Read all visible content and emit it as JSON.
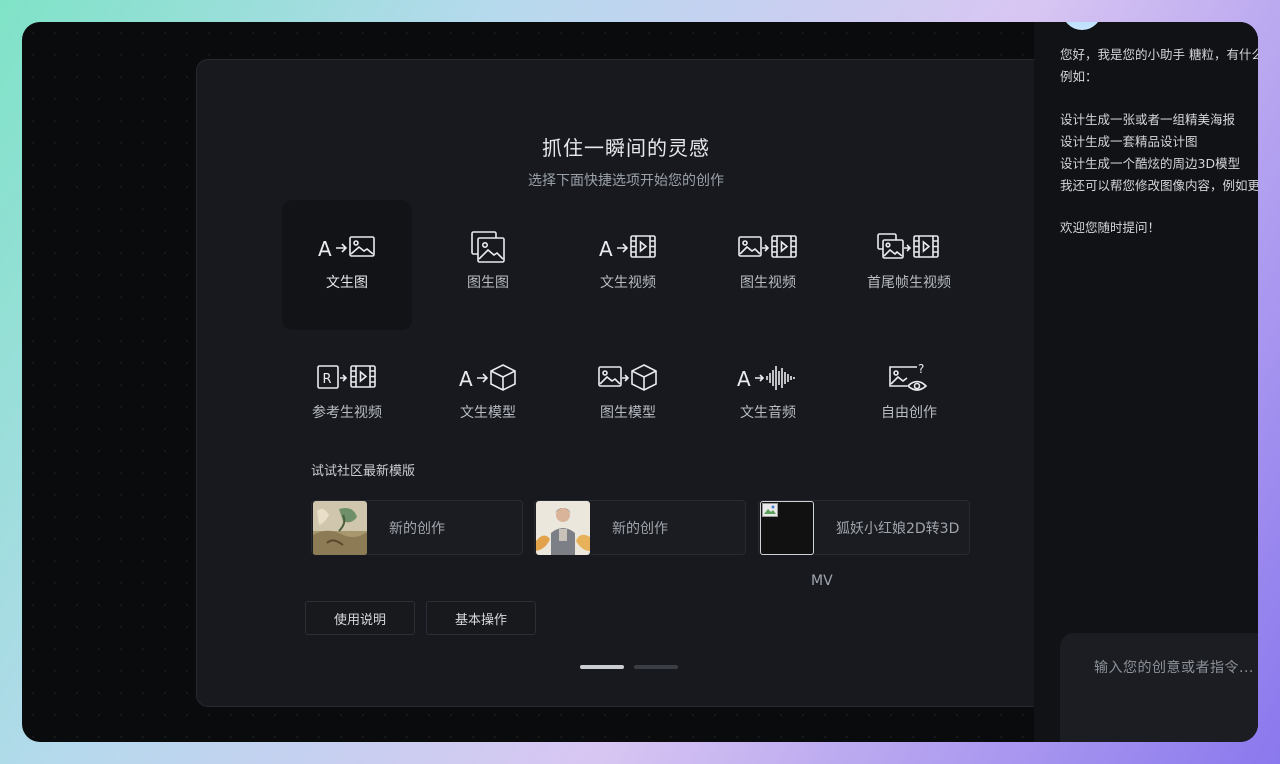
{
  "modal": {
    "title": "抓住一瞬间的灵感",
    "subtitle": "选择下面快捷选项开始您的创作",
    "close_icon": "×",
    "options": [
      {
        "label": "文生图",
        "icon": "text-to-image-icon"
      },
      {
        "label": "图生图",
        "icon": "image-to-image-icon"
      },
      {
        "label": "文生视频",
        "icon": "text-to-video-icon"
      },
      {
        "label": "图生视频",
        "icon": "image-to-video-icon"
      },
      {
        "label": "首尾帧生视频",
        "icon": "frames-to-video-icon"
      },
      {
        "label": "参考生视频",
        "icon": "reference-to-video-icon"
      },
      {
        "label": "文生模型",
        "icon": "text-to-model-icon"
      },
      {
        "label": "图生模型",
        "icon": "image-to-model-icon"
      },
      {
        "label": "文生音频",
        "icon": "text-to-audio-icon"
      },
      {
        "label": "自由创作",
        "icon": "free-creation-icon"
      }
    ],
    "icon_letters": {
      "a": "A",
      "r": "R",
      "question": "?"
    },
    "community_title": "试试社区最新模版",
    "templates": [
      {
        "name": "新的创作"
      },
      {
        "name": "新的创作"
      },
      {
        "name": "狐妖小红娘2D转3D",
        "name_wrap": "MV"
      }
    ],
    "buttons": {
      "usage": "使用说明",
      "basic": "基本操作"
    },
    "pagination": {
      "active_page": 1,
      "total_pages": 2
    }
  },
  "assistant": {
    "messages": [
      "您好，我是您的小助手 糖粒，有什么可以帮您的",
      "例如：",
      "设计生成一张或者一组精美海报",
      "设计生成一套精品设计图",
      "设计生成一个酷炫的周边3D模型",
      "我还可以帮您修改图像内容，例如更换背景",
      "欢迎您随时提问！"
    ],
    "input_placeholder": "输入您的创意或者指令..."
  },
  "colors": {
    "icon_stroke": "#e9ebee",
    "modal_bg": "#17191e",
    "panel_bg": "#111215",
    "active_dot": "#c9ccd1",
    "inactive_dot": "#3a3d44"
  }
}
